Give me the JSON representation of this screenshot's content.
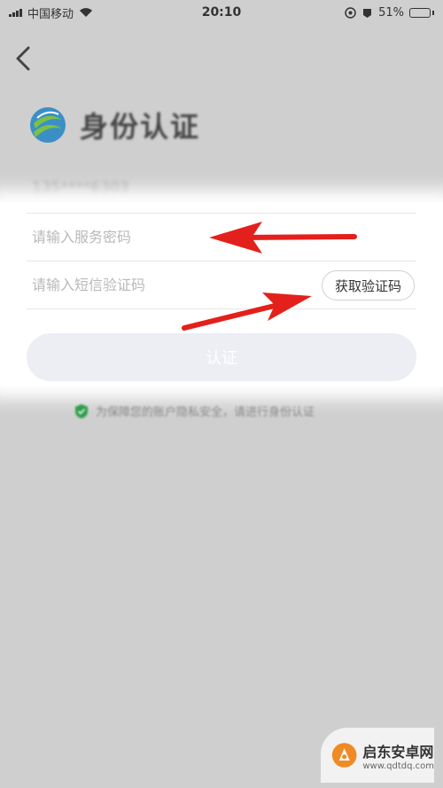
{
  "status_bar": {
    "carrier": "中国移动",
    "time": "20:10",
    "battery_percent": "51%",
    "battery_level": 0.51,
    "icons": [
      "signal-icon",
      "wifi-icon",
      "location-icon",
      "alarm-icon",
      "battery-icon"
    ]
  },
  "header": {
    "back_icon": "chevron-left-icon",
    "title": "身份认证"
  },
  "form": {
    "phone": "135****6303",
    "password_placeholder": "请输入服务密码",
    "sms_placeholder": "请输入短信验证码",
    "sms_button_label": "获取验证码",
    "submit_label": "认证"
  },
  "notice": {
    "text": "为保障您的账户隐私安全，请进行身份认证",
    "icon": "shield-check-icon"
  },
  "watermark": {
    "name": "启东安卓网",
    "url": "www.qdtdq.com"
  },
  "colors": {
    "background": "#cfcfcf",
    "arrow": "#e3201b",
    "button_disabled": "#eceef4",
    "battery_green": "#4cd964"
  }
}
